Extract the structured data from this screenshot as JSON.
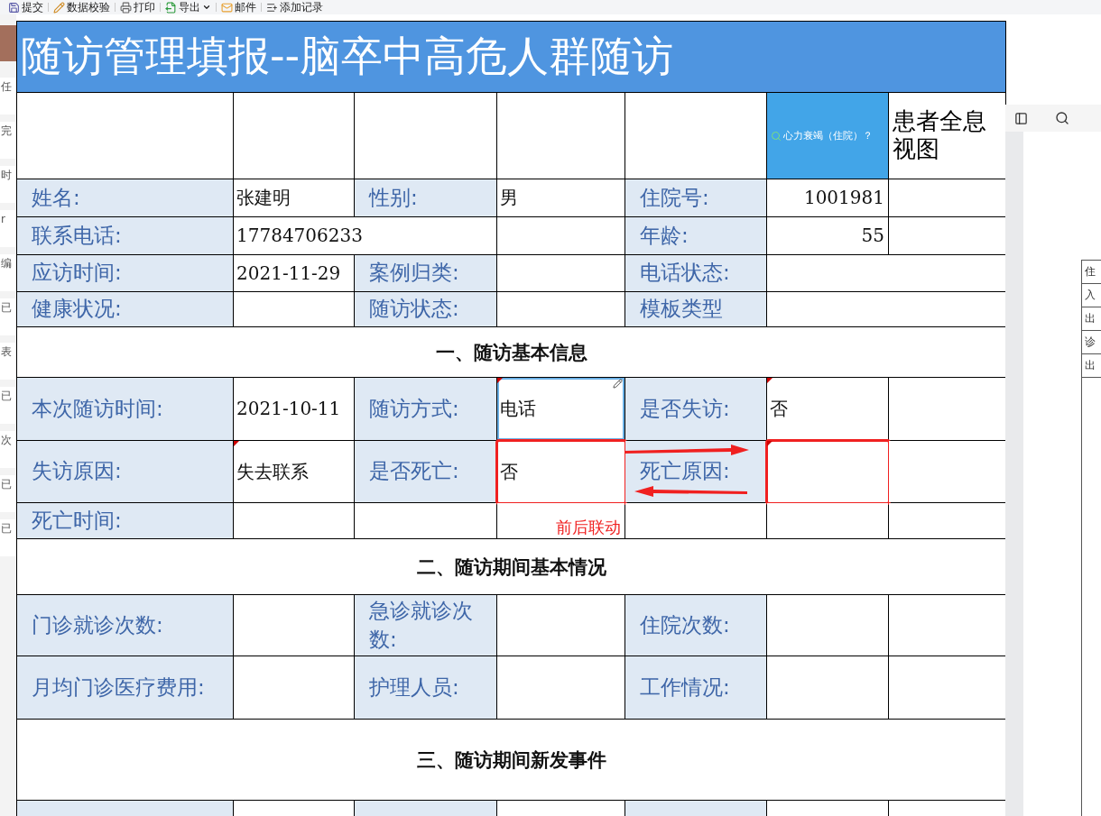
{
  "toolbar": [
    {
      "kind": "save",
      "label": "提交"
    },
    {
      "kind": "check",
      "label": "数据校验"
    },
    {
      "kind": "print",
      "label": "打印"
    },
    {
      "kind": "export",
      "label": "导出",
      "has_menu": true
    },
    {
      "kind": "mail",
      "label": "邮件"
    },
    {
      "kind": "add",
      "label": "添加记录"
    }
  ],
  "side_strip": [
    "任",
    "完",
    "时",
    "r",
    "编",
    "已",
    "表",
    "已",
    "次",
    "已",
    "已"
  ],
  "form": {
    "title": "随访管理填报--脑卒中高危人群随访",
    "header": {
      "summary_button": "心力衰竭（住院）？",
      "side_title": "患者全息视图"
    },
    "rows": [
      {
        "kind": "cells",
        "cells": [
          {
            "kind": "label",
            "text": "姓名:"
          },
          {
            "kind": "value",
            "text": "张建明"
          },
          {
            "kind": "label",
            "text": "性别:"
          },
          {
            "kind": "value",
            "text": "男"
          },
          {
            "kind": "label",
            "text": "住院号:"
          },
          {
            "kind": "number",
            "text": "1001981"
          },
          {
            "kind": "empty"
          }
        ]
      },
      {
        "kind": "cells",
        "cells": [
          {
            "kind": "label",
            "text": "联系电话:"
          },
          {
            "kind": "wide_value",
            "text": "17784706233"
          },
          {
            "kind": "empty"
          },
          {
            "kind": "label",
            "text": "年龄:"
          },
          {
            "kind": "number",
            "text": "55"
          },
          {
            "kind": "empty"
          }
        ]
      },
      {
        "kind": "cells",
        "cells": [
          {
            "kind": "label",
            "text": "应访时间:"
          },
          {
            "kind": "value",
            "text": "2021-11-29"
          },
          {
            "kind": "label",
            "text": "案例归类:"
          },
          {
            "kind": "empty"
          },
          {
            "kind": "label",
            "text": "电话状态:"
          },
          {
            "kind": "wide_empty"
          }
        ]
      },
      {
        "kind": "cells",
        "cells": [
          {
            "kind": "label",
            "text": "健康状况:"
          },
          {
            "kind": "empty"
          },
          {
            "kind": "label",
            "text": "随访状态:"
          },
          {
            "kind": "empty"
          },
          {
            "kind": "label",
            "text": "模板类型"
          },
          {
            "kind": "wide_empty"
          }
        ]
      },
      {
        "kind": "section",
        "text": "一、随访基本信息"
      },
      {
        "kind": "cells",
        "cells": [
          {
            "kind": "label",
            "text": "本次随访时间:"
          },
          {
            "kind": "value",
            "text": "2021-10-11"
          },
          {
            "kind": "label",
            "text": "随访方式:"
          },
          {
            "kind": "value",
            "text": "电话",
            "marked": true,
            "selected": true
          },
          {
            "kind": "label",
            "text": "是否失访:"
          },
          {
            "kind": "value",
            "text": "否",
            "marked": true
          },
          {
            "kind": "empty"
          }
        ]
      },
      {
        "kind": "cells",
        "cells": [
          {
            "kind": "label",
            "text": "失访原因:"
          },
          {
            "kind": "value",
            "text": "失去联系",
            "marked": true
          },
          {
            "kind": "label",
            "text": "是否死亡:"
          },
          {
            "kind": "value",
            "text": "否",
            "outlined": true
          },
          {
            "kind": "label",
            "text": "死亡原因:"
          },
          {
            "kind": "empty",
            "outlined": true,
            "marked": true
          },
          {
            "kind": "empty"
          }
        ]
      },
      {
        "kind": "cells",
        "cells": [
          {
            "kind": "label",
            "text": "死亡时间:"
          },
          {
            "kind": "empty"
          },
          {
            "kind": "empty"
          },
          {
            "kind": "empty"
          },
          {
            "kind": "empty"
          },
          {
            "kind": "empty"
          },
          {
            "kind": "empty"
          }
        ]
      },
      {
        "kind": "section",
        "text": "二、随访期间基本情况"
      },
      {
        "kind": "cells",
        "cells": [
          {
            "kind": "label",
            "text": "门诊就诊次数:"
          },
          {
            "kind": "empty"
          },
          {
            "kind": "label",
            "text": "急诊就诊次数:"
          },
          {
            "kind": "empty"
          },
          {
            "kind": "label",
            "text": "住院次数:"
          },
          {
            "kind": "empty"
          },
          {
            "kind": "empty"
          }
        ]
      },
      {
        "kind": "cells",
        "cells": [
          {
            "kind": "label",
            "text": "月均门诊医疗费用:"
          },
          {
            "kind": "empty"
          },
          {
            "kind": "label",
            "text": "护理人员:"
          },
          {
            "kind": "empty"
          },
          {
            "kind": "label",
            "text": "工作情况:"
          },
          {
            "kind": "empty"
          },
          {
            "kind": "empty"
          }
        ]
      },
      {
        "kind": "section",
        "text": "三、随访期间新发事件"
      },
      {
        "kind": "cells",
        "cells": [
          {
            "kind": "label"
          },
          {
            "kind": "empty"
          },
          {
            "kind": "label"
          },
          {
            "kind": "empty"
          },
          {
            "kind": "label"
          },
          {
            "kind": "empty"
          },
          {
            "kind": "empty"
          }
        ]
      }
    ],
    "annotation": "前后联动"
  },
  "preview_lines": [
    "住",
    "入",
    "出",
    "诊",
    "出"
  ]
}
